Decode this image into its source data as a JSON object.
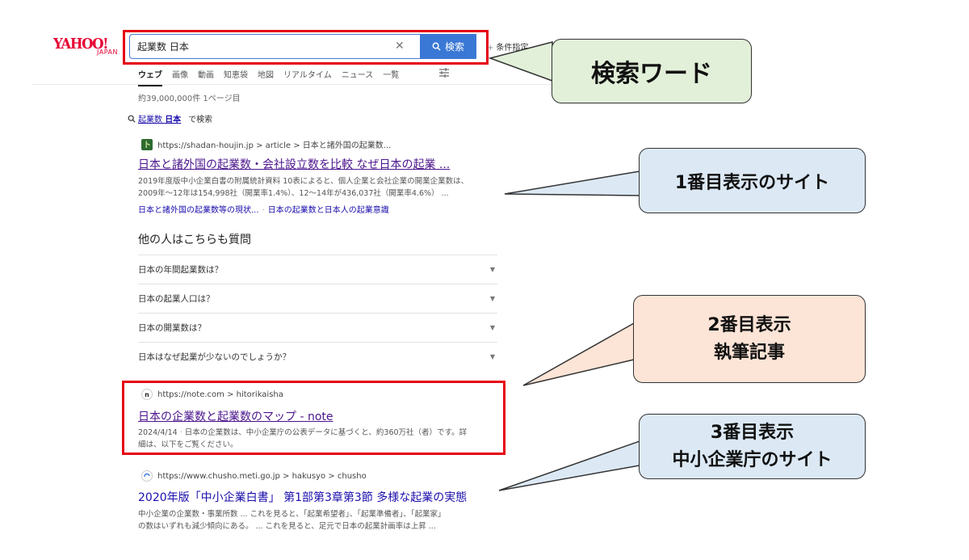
{
  "logo": {
    "main": "YAHOO!",
    "sub": "JAPAN"
  },
  "search": {
    "query": "起業数 日本",
    "button_label": "検索",
    "condition_label": "条件指定"
  },
  "tabs": [
    {
      "label": "ウェブ",
      "active": true
    },
    {
      "label": "画像"
    },
    {
      "label": "動画"
    },
    {
      "label": "知恵袋"
    },
    {
      "label": "地図"
    },
    {
      "label": "リアルタイム"
    },
    {
      "label": "ニュース"
    },
    {
      "label": "一覧"
    }
  ],
  "result_count": "約39,000,000件 1ページ目",
  "suggest": {
    "prefix": "起業数",
    "bold": "日本",
    "suffix": "で検索"
  },
  "results": [
    {
      "url": "https://shadan-houjin.jp > article > 日本と諸外国の起業数...",
      "title": "日本と諸外国の起業数・会社設立数を比較 なぜ日本の起業 ...",
      "snippet_line1": "2019年度版中小企業白書の附属統計資料 10表によると、個人企業と会社企業の開業企業数は、",
      "snippet_line2": "2009年～12年は154,998社（開業率1.4%）、12～14年が436,037社（開業率4.6%） ...",
      "links": [
        "日本と諸外国の起業数等の現状...",
        "日本の起業数と日本人の起業意識"
      ]
    },
    {
      "url": "https://note.com > hitorikaisha",
      "title": "日本の企業数と起業数のマップ - note",
      "date": "2024/4/14",
      "snippet_line1": "日本の企業数は、中小企業庁の公表データに基づくと、約360万社（者）です。詳",
      "snippet_line2": "細は、以下をご覧ください。"
    },
    {
      "url": "https://www.chusho.meti.go.jp > hakusyo > chusho",
      "title": "2020年版「中小企業白書」 第1部第3章第3節 多様な起業の実態",
      "snippet_line1": "中小企業の企業数・事業所数 ... これを見ると、「起業希望者」、「起業準備者」、「起業家」",
      "snippet_line2": "の数はいずれも減少傾向にある。 ... これを見ると、足元で日本の起業計画率は上昇 ..."
    }
  ],
  "paa": {
    "title": "他の人はこちらも質問",
    "items": [
      "日本の年間起業数は？",
      "日本の起業人口は？",
      "日本の開業数は？",
      "日本はなぜ起業が少ないのでしょうか？"
    ]
  },
  "callouts": {
    "search_word": "検索ワード",
    "first": "1番目表示のサイト",
    "second_line1": "2番目表示",
    "second_line2": "執筆記事",
    "third_line1": "3番目表示",
    "third_line2": "中小企業庁のサイト"
  },
  "colors": {
    "highlight_red": "#e60012",
    "search_blue": "#3a78d6",
    "link_blue": "#1a0dab",
    "visited_purple": "#4a148c"
  }
}
